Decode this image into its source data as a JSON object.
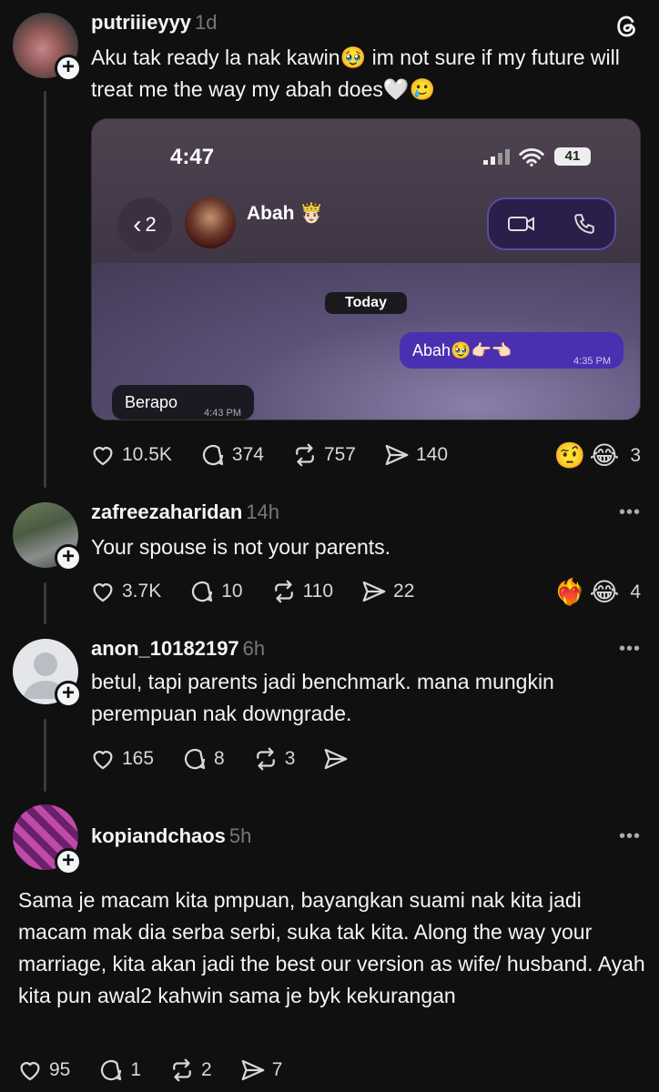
{
  "app": {
    "logo": "threads-icon"
  },
  "posts": [
    {
      "username": "putriiieyyy",
      "time": "1d",
      "text": "Aku tak ready la nak kawin🥹 im not sure if my future will treat me the way my abah does🤍🥲",
      "embedded": {
        "clock": "4:47",
        "battery": "41",
        "back_count": "2",
        "contact_name": "Abah 🤴🏻",
        "date_chip": "Today",
        "outgoing_message": "Abah🥹👉🏻👈🏻",
        "outgoing_time": "4:35 PM",
        "incoming_message": "Berapo",
        "incoming_time": "4:43 PM"
      },
      "likes": "10.5K",
      "replies": "374",
      "reposts": "757",
      "shares": "140",
      "reactions": [
        "🤨",
        "😂"
      ],
      "reaction_count": "3"
    },
    {
      "username": "zafreezaharidan",
      "time": "14h",
      "text": "Your spouse is not your parents.",
      "likes": "3.7K",
      "replies": "10",
      "reposts": "110",
      "shares": "22",
      "reactions": [
        "❤️‍🔥",
        "😂"
      ],
      "reaction_count": "4"
    },
    {
      "username": "anon_10182197",
      "time": "6h",
      "text": "betul, tapi parents jadi benchmark. mana mungkin perempuan nak downgrade.",
      "likes": "165",
      "replies": "8",
      "reposts": "3"
    },
    {
      "username": "kopiandchaos",
      "time": "5h",
      "text": "Sama je macam kita pmpuan, bayangkan suami nak kita jadi macam mak dia serba serbi, suka tak kita. Along the way your marriage, kita akan jadi the best our version as wife/ husband. Ayah kita pun awal2 kahwin sama je byk kekurangan",
      "likes": "95",
      "replies": "1",
      "reposts": "2",
      "shares": "7"
    }
  ],
  "more_label": "•••",
  "follow_label": "+"
}
